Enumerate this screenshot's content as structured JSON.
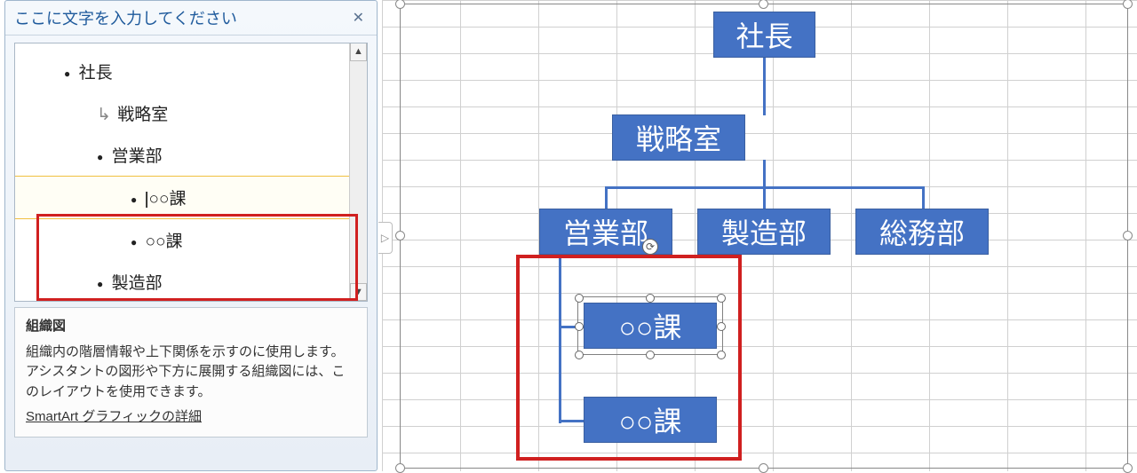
{
  "textPane": {
    "title": "ここに文字を入力してください",
    "closeLabel": "✕",
    "items": {
      "i0": "社長",
      "i1": "戦略室",
      "i2": "営業部",
      "i3": "○○課",
      "i4": "○○課",
      "i5": "製造部"
    },
    "desc": {
      "heading": "組織図",
      "body": "組織内の階層情報や上下関係を示すのに使用します。アシスタントの図形や下方に展開する組織図には、このレイアウトを使用できます。",
      "link": "SmartArt グラフィックの詳細"
    }
  },
  "chart": {
    "n_president": "社長",
    "n_strategy": "戦略室",
    "n_sales": "営業部",
    "n_mfg": "製造部",
    "n_general": "総務部",
    "n_section1": "○○課",
    "n_section2": "○○課"
  },
  "scroll": {
    "up": "▲",
    "down": "▼"
  },
  "expandTab": "▷",
  "rotateGlyph": "⟳"
}
